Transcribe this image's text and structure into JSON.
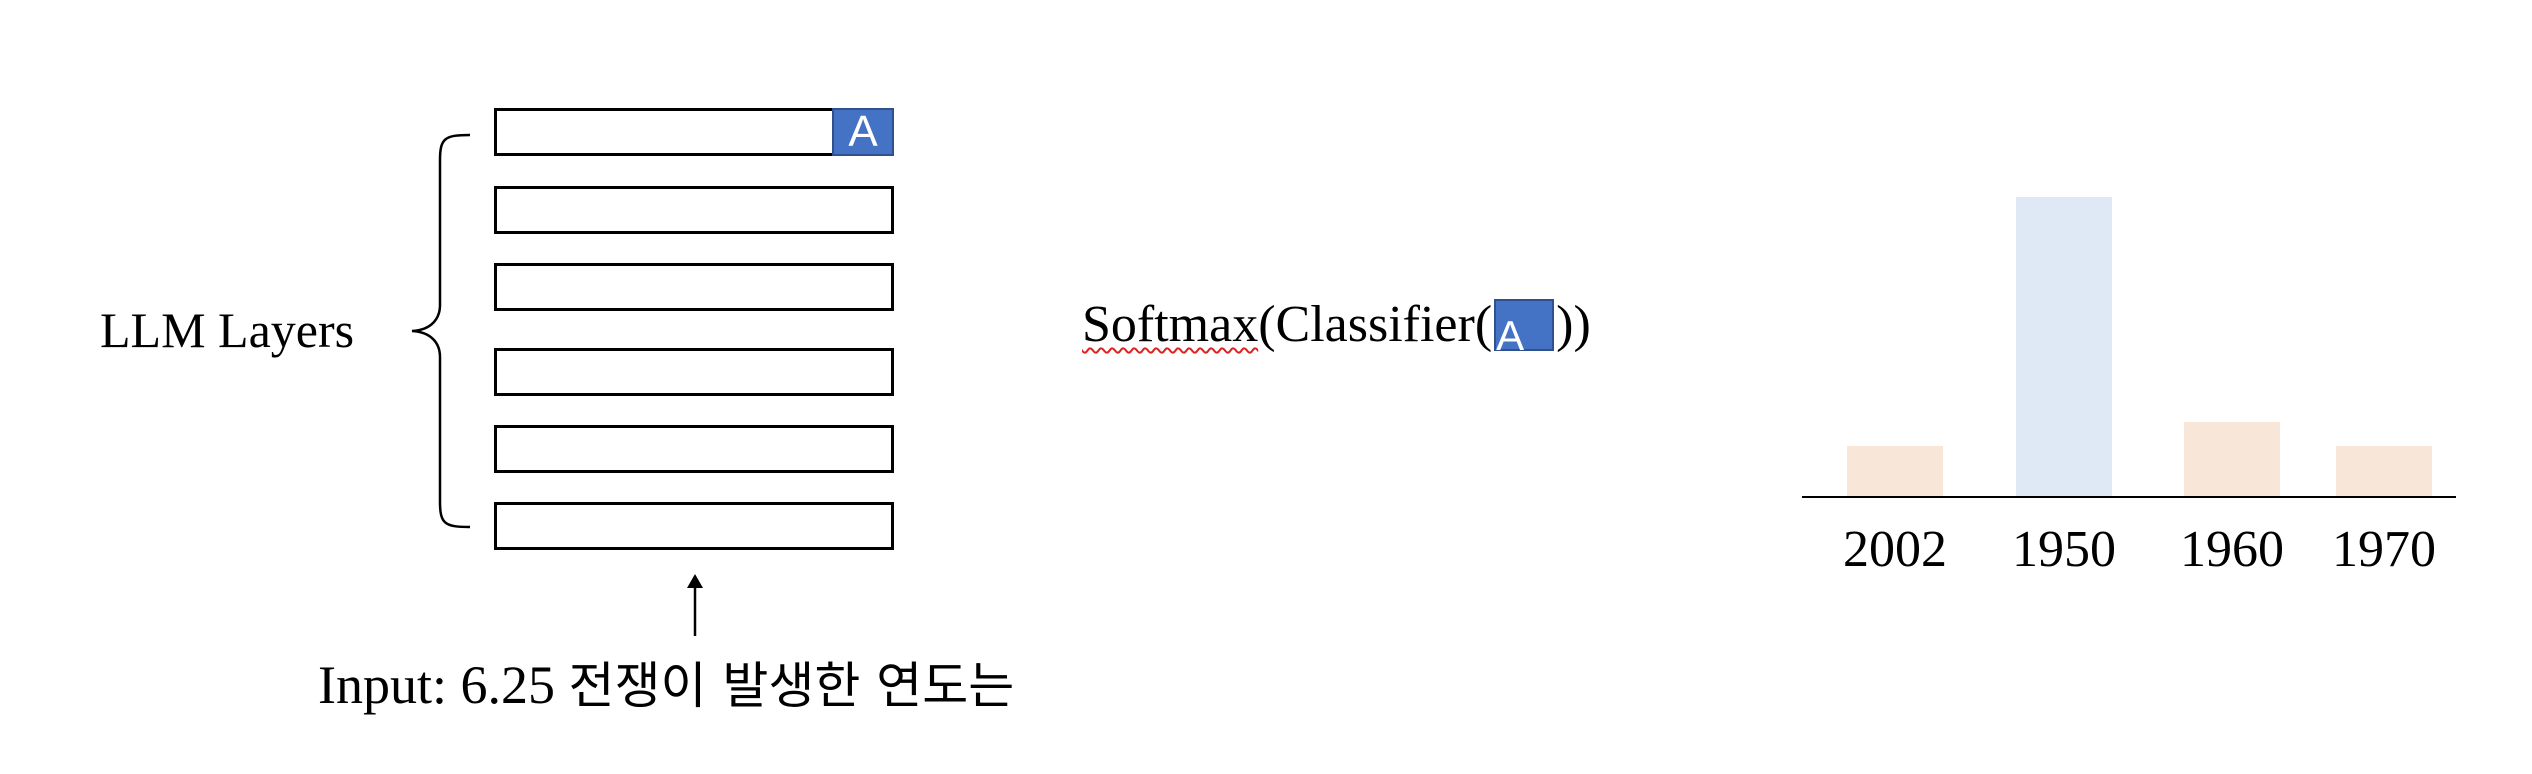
{
  "diagram": {
    "layers_label": "LLM Layers",
    "token_label": "A",
    "input_prefix": "Input: 6.25 ",
    "input_korean": "전쟁이 발생한 연도는",
    "formula": {
      "softmax": "Softmax",
      "classifier_open": "(Classifier(",
      "token": "A",
      "close": "))"
    },
    "layer_count": 6
  },
  "colors": {
    "token_blue": "#4472c4",
    "bar_highlight": "#dfe9f5",
    "bar_other": "#f8e6d9"
  },
  "chart_data": {
    "type": "bar",
    "categories": [
      "2002",
      "1950",
      "1960",
      "1970"
    ],
    "values": [
      0.17,
      1.0,
      0.25,
      0.17
    ],
    "highlight_index": 1,
    "title": "",
    "xlabel": "",
    "ylabel": ""
  }
}
